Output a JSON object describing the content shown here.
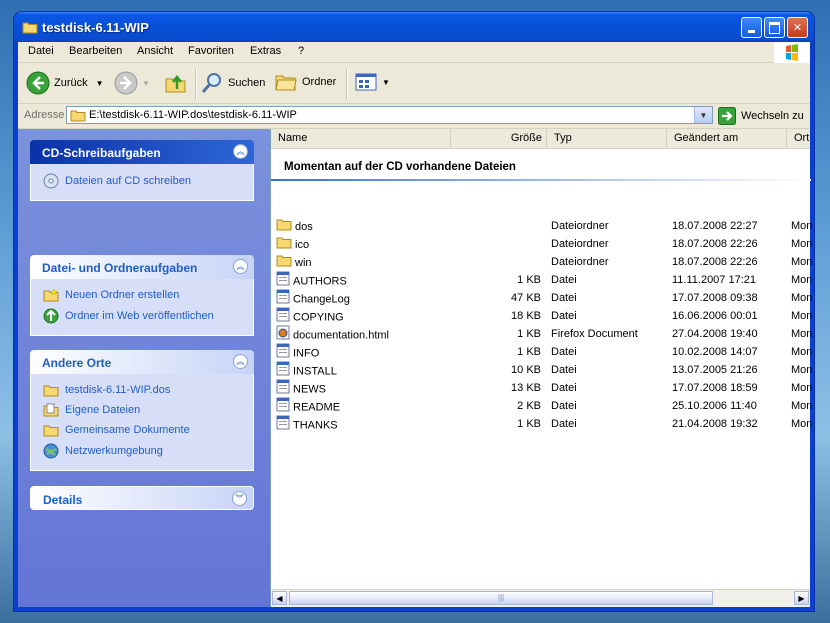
{
  "window": {
    "title": "testdisk-6.11-WIP"
  },
  "menu": [
    "Datei",
    "Bearbeiten",
    "Ansicht",
    "Favoriten",
    "Extras",
    "?"
  ],
  "toolbar": {
    "back": "Zurück",
    "search": "Suchen",
    "folders": "Ordner"
  },
  "address": {
    "label": "Adresse",
    "path": "E:\\testdisk-6.11-WIP.dos\\testdisk-6.11-WIP",
    "go": "Wechseln zu"
  },
  "sidebar": {
    "cd_tasks": {
      "title": "CD-Schreibaufgaben",
      "items": [
        "Dateien auf CD schreiben"
      ]
    },
    "file_tasks": {
      "title": "Datei- und Ordneraufgaben",
      "items": [
        "Neuen Ordner erstellen",
        "Ordner im Web veröffentlichen"
      ]
    },
    "places": {
      "title": "Andere Orte",
      "items": [
        "testdisk-6.11-WIP.dos",
        "Eigene Dateien",
        "Gemeinsame Dokumente",
        "Netzwerkumgebung"
      ]
    },
    "details": {
      "title": "Details"
    }
  },
  "columns": {
    "name": "Name",
    "size": "Größe",
    "type": "Typ",
    "modified": "Geändert am",
    "attr": "Ort"
  },
  "group_title": "Momentan auf der CD vorhandene Dateien",
  "files": [
    {
      "name": "dos",
      "size": "",
      "type": "Dateiordner",
      "date": "18.07.2008 22:27",
      "extra": "Mon",
      "icon": "folder-icon"
    },
    {
      "name": "ico",
      "size": "",
      "type": "Dateiordner",
      "date": "18.07.2008 22:26",
      "extra": "Mon",
      "icon": "folder-icon"
    },
    {
      "name": "win",
      "size": "",
      "type": "Dateiordner",
      "date": "18.07.2008 22:26",
      "extra": "Mon",
      "icon": "folder-icon"
    },
    {
      "name": "AUTHORS",
      "size": "1 KB",
      "type": "Datei",
      "date": "11.11.2007 17:21",
      "extra": "Mon",
      "icon": "file-icon"
    },
    {
      "name": "ChangeLog",
      "size": "47 KB",
      "type": "Datei",
      "date": "17.07.2008 09:38",
      "extra": "Mon",
      "icon": "file-icon"
    },
    {
      "name": "COPYING",
      "size": "18 KB",
      "type": "Datei",
      "date": "16.06.2006 00:01",
      "extra": "Mon",
      "icon": "file-icon"
    },
    {
      "name": "documentation.html",
      "size": "1 KB",
      "type": "Firefox Document",
      "date": "27.04.2008 19:40",
      "extra": "Mon",
      "icon": "html-file-icon"
    },
    {
      "name": "INFO",
      "size": "1 KB",
      "type": "Datei",
      "date": "10.02.2008 14:07",
      "extra": "Mon",
      "icon": "file-icon"
    },
    {
      "name": "INSTALL",
      "size": "10 KB",
      "type": "Datei",
      "date": "13.07.2005 21:26",
      "extra": "Mon",
      "icon": "file-icon"
    },
    {
      "name": "NEWS",
      "size": "13 KB",
      "type": "Datei",
      "date": "17.07.2008 18:59",
      "extra": "Mon",
      "icon": "file-icon"
    },
    {
      "name": "README",
      "size": "2 KB",
      "type": "Datei",
      "date": "25.10.2006 11:40",
      "extra": "Mon",
      "icon": "file-icon"
    },
    {
      "name": "THANKS",
      "size": "1 KB",
      "type": "Datei",
      "date": "21.04.2008 19:32",
      "extra": "Mon",
      "icon": "file-icon"
    }
  ]
}
